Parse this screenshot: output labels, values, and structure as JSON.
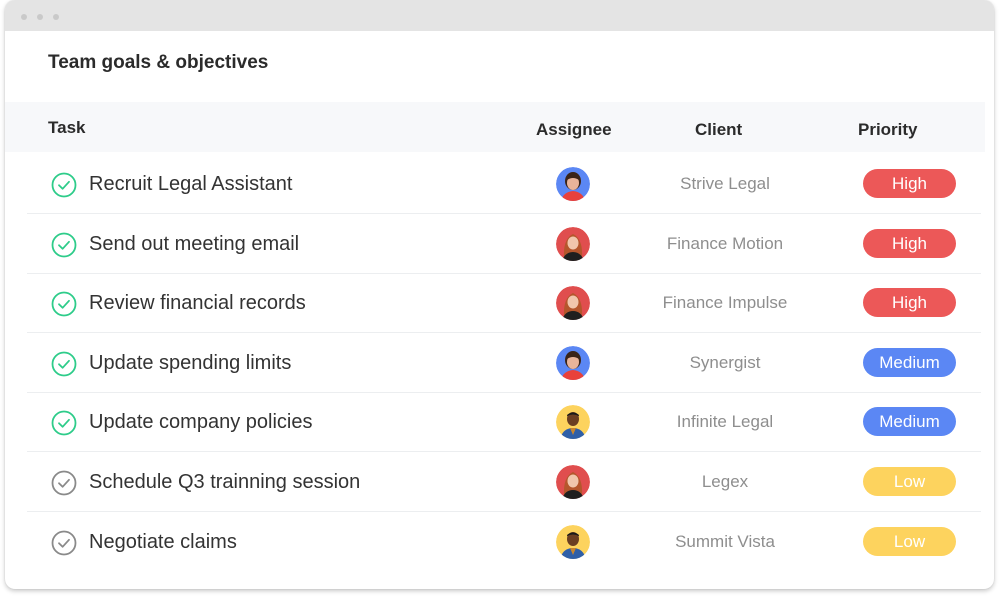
{
  "window": {
    "controls": [
      "close",
      "minimize",
      "maximize"
    ]
  },
  "page": {
    "title": "Team goals & objectives"
  },
  "table": {
    "headers": {
      "task": "Task",
      "assignee": "Assignee",
      "client": "Client",
      "priority": "Priority"
    },
    "rows": [
      {
        "task": "Recruit Legal Assistant",
        "status": "complete",
        "assignee": "woman-dark-hair",
        "client": "Strive Legal",
        "priority": "High"
      },
      {
        "task": "Send out meeting email",
        "status": "complete",
        "assignee": "woman-red-hair",
        "client": "Finance Motion",
        "priority": "High"
      },
      {
        "task": "Review financial records",
        "status": "complete",
        "assignee": "woman-red-hair",
        "client": "Finance Impulse",
        "priority": "High"
      },
      {
        "task": "Update spending limits",
        "status": "complete",
        "assignee": "woman-dark-hair",
        "client": "Synergist",
        "priority": "Medium"
      },
      {
        "task": "Update company policies",
        "status": "complete",
        "assignee": "man-blue-suit",
        "client": "Infinite Legal",
        "priority": "Medium"
      },
      {
        "task": "Schedule Q3 trainning session",
        "status": "incomplete",
        "assignee": "woman-red-hair",
        "client": "Legex",
        "priority": "Low"
      },
      {
        "task": "Negotiate claims",
        "status": "incomplete",
        "assignee": "man-blue-suit",
        "client": "Summit Vista",
        "priority": "Low"
      }
    ]
  },
  "colors": {
    "complete": "#2ecc8a",
    "incomplete": "#8a8a8a",
    "High": "#ec5858",
    "Medium": "#5b87f4",
    "Low": "#fdd35e",
    "avatar_bg": {
      "woman-dark-hair": "#5b87f4",
      "woman-red-hair": "#e04e4e",
      "man-blue-suit": "#fdd35e"
    }
  }
}
